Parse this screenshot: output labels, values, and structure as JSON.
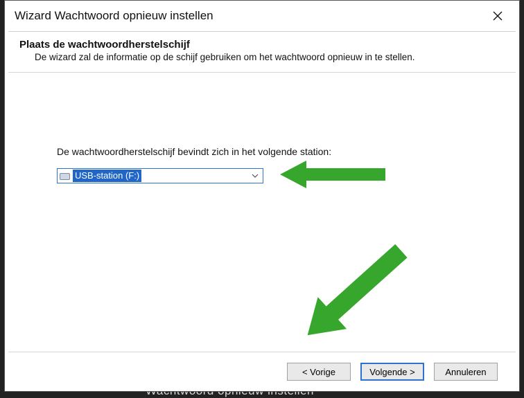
{
  "title": "Wizard Wachtwoord opnieuw instellen",
  "header": {
    "title": "Plaats de wachtwoordherstelschijf",
    "subtitle": "De wizard zal de informatie op de schijf gebruiken om het wachtwoord opnieuw in te stellen."
  },
  "body": {
    "label": "De wachtwoordherstelschijf bevindt zich in het volgende station:",
    "drive_selected": "USB-station (F:)"
  },
  "buttons": {
    "back": "< Vorige",
    "next": "Volgende >",
    "cancel": "Annuleren"
  },
  "background_hint": "Wachtwoord opnieuw instellen",
  "colors": {
    "accent_blue": "#2a74d0",
    "arrow_green": "#37a62c"
  }
}
